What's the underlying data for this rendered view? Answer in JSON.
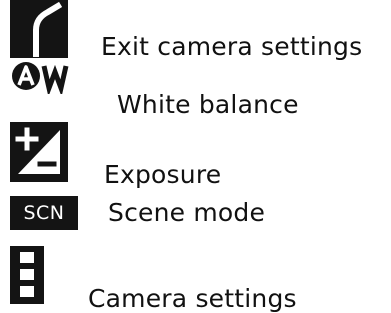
{
  "legend": {
    "items": [
      {
        "icon": "exit-camera-settings-icon",
        "label": "Exit camera settings"
      },
      {
        "icon": "white-balance-auto-icon",
        "label": "White balance",
        "icon_text": "AW"
      },
      {
        "icon": "exposure-icon",
        "label": "Exposure"
      },
      {
        "icon": "scene-mode-icon",
        "label": "Scene mode",
        "icon_text": "SCN"
      },
      {
        "icon": "camera-settings-icon",
        "label": "Camera settings"
      }
    ]
  },
  "colors": {
    "icon_background": "#141414",
    "icon_foreground": "#ffffff",
    "text": "#111111"
  }
}
